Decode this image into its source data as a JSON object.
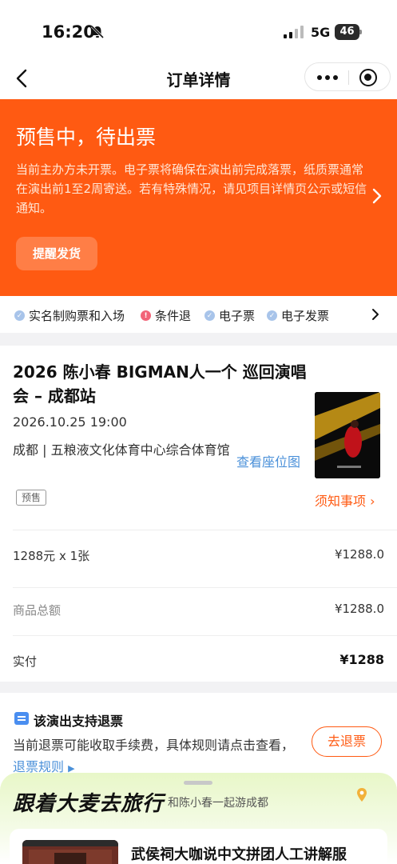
{
  "status_bar": {
    "time": "16:20",
    "network": "5G",
    "battery": "46"
  },
  "nav": {
    "title": "订单详情"
  },
  "banner": {
    "title": "预售中，待出票",
    "description": "当前主办方未开票。电子票将确保在演出前完成落票，纸质票通常在演出前1至2周寄送。若有特殊情况，请见项目详情页公示或短信通知。",
    "remind_button": "提醒发货"
  },
  "features": [
    {
      "label": "实名制购票和入场",
      "icon": "check-circle-icon",
      "color": "#a8c4ea"
    },
    {
      "label": "条件退",
      "icon": "alert-circle-icon",
      "color": "#f26478"
    },
    {
      "label": "电子票",
      "icon": "check-circle-icon",
      "color": "#a8c4ea"
    },
    {
      "label": "电子发票",
      "icon": "check-circle-icon",
      "color": "#a8c4ea"
    }
  ],
  "show": {
    "title": "2026 陈小春 BIGMAN人一个 巡回演唱会 – 成都站",
    "datetime": "2026.10.25 19:00",
    "venue": "成都 | 五粮液文化体育中心综合体育馆",
    "seat_link": "查看座位图",
    "presale_tag": "预售",
    "notice_link": "须知事项"
  },
  "price": {
    "ticket_line": "1288元 x 1张",
    "ticket_amount": "¥1288.0",
    "subtotal_label": "商品总额",
    "subtotal_amount": "¥1288.0",
    "paid_label": "实付",
    "paid_amount": "¥1288"
  },
  "refund": {
    "title": "该演出支持退票",
    "description": "当前退票可能收取手续费，具体规则请点击查看，",
    "rules_link": "退票规则",
    "button": "去退票"
  },
  "promo": {
    "logo": "跟着大麦去旅行",
    "subtitle": "和陈小春一起游成都",
    "card_title": "武侯祠大咖说中文拼团人工讲解服"
  },
  "colors": {
    "accent": "#ff5a12",
    "link": "#4a90d9"
  }
}
